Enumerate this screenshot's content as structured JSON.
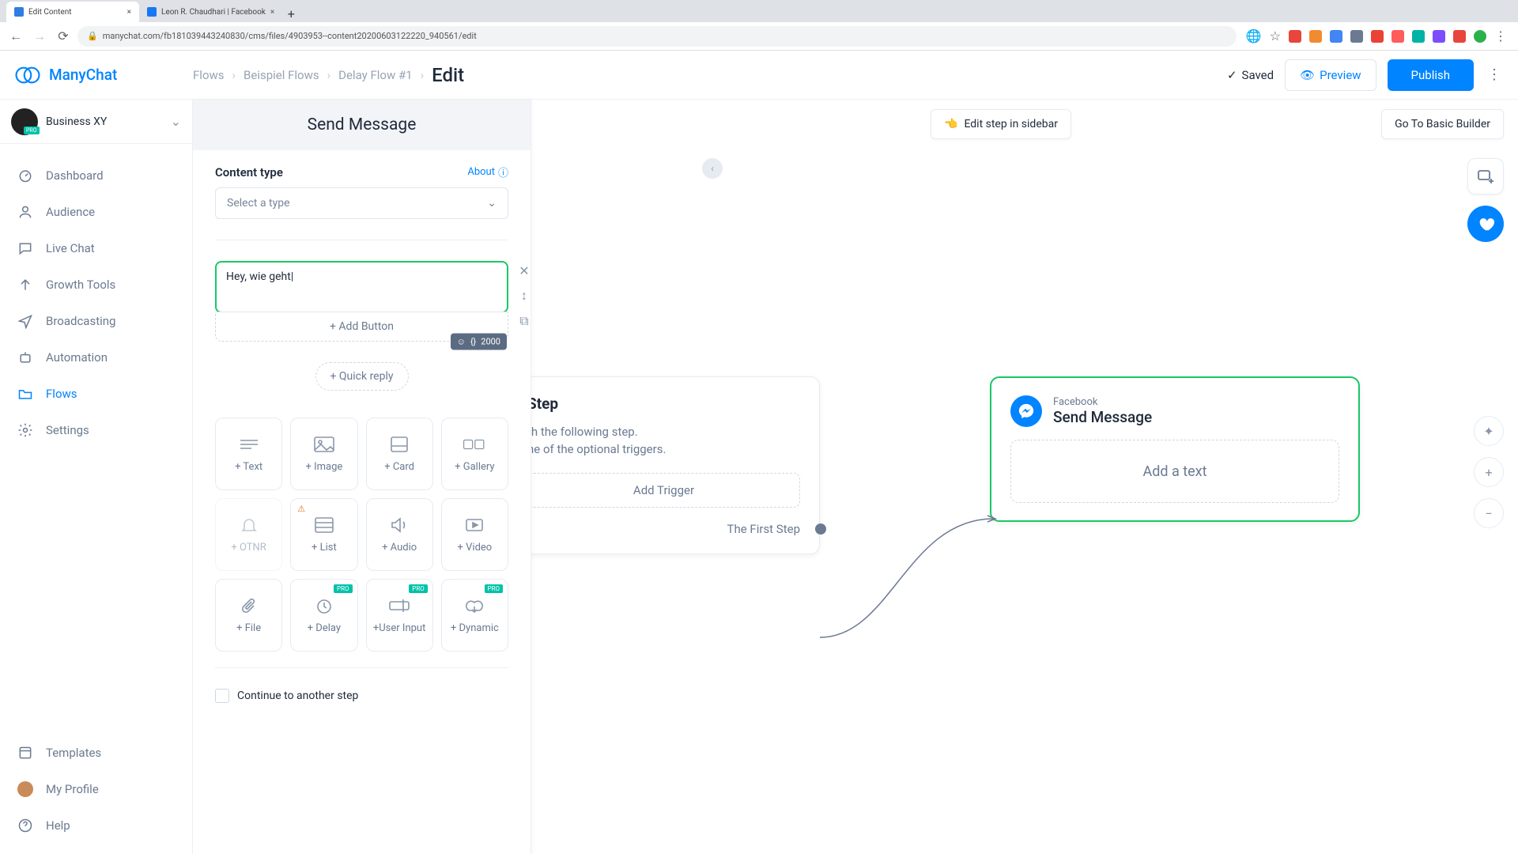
{
  "browser": {
    "tabs": [
      {
        "title": "Edit Content",
        "active": true
      },
      {
        "title": "Leon R. Chaudhari | Facebook",
        "active": false
      }
    ],
    "url": "manychat.com/fb181039443240830/cms/files/4903953--content20200603122220_940561/edit"
  },
  "header": {
    "logo": "ManyChat",
    "breadcrumb": [
      "Flows",
      "Beispiel Flows",
      "Delay Flow #1"
    ],
    "current": "Edit",
    "saved": "Saved",
    "preview": "Preview",
    "publish": "Publish"
  },
  "account": {
    "name": "Business XY",
    "badge": "PRO"
  },
  "nav": {
    "items": [
      {
        "key": "dashboard",
        "label": "Dashboard"
      },
      {
        "key": "audience",
        "label": "Audience"
      },
      {
        "key": "livechat",
        "label": "Live Chat"
      },
      {
        "key": "growth",
        "label": "Growth Tools"
      },
      {
        "key": "broadcasting",
        "label": "Broadcasting"
      },
      {
        "key": "automation",
        "label": "Automation"
      },
      {
        "key": "flows",
        "label": "Flows",
        "active": true
      },
      {
        "key": "settings",
        "label": "Settings"
      }
    ],
    "bottom": [
      {
        "key": "templates",
        "label": "Templates"
      },
      {
        "key": "profile",
        "label": "My Profile"
      },
      {
        "key": "help",
        "label": "Help"
      }
    ]
  },
  "panel": {
    "title": "Send Message",
    "content_type_label": "Content type",
    "about": "About",
    "select_placeholder": "Select a type",
    "message_text": "Hey, wie geht",
    "counter": "2000",
    "add_button": "+ Add Button",
    "quick_reply": "+ Quick reply",
    "blocks": [
      {
        "label": "+ Text",
        "icon": "text"
      },
      {
        "label": "+ Image",
        "icon": "image"
      },
      {
        "label": "+ Card",
        "icon": "card"
      },
      {
        "label": "+ Gallery",
        "icon": "gallery"
      },
      {
        "label": "+ OTNR",
        "icon": "bell",
        "disabled": true
      },
      {
        "label": "+ List",
        "icon": "list",
        "warn": true
      },
      {
        "label": "+ Audio",
        "icon": "audio"
      },
      {
        "label": "+ Video",
        "icon": "video"
      },
      {
        "label": "+ File",
        "icon": "file"
      },
      {
        "label": "+ Delay",
        "icon": "delay",
        "pro": true
      },
      {
        "label": "+User Input",
        "icon": "input",
        "pro": true
      },
      {
        "label": "+ Dynamic",
        "icon": "dynamic",
        "pro": true
      }
    ],
    "continue": "Continue to another step"
  },
  "canvas": {
    "edit_step": "Edit step in sidebar",
    "edit_step_emoji": "👈",
    "basic_builder": "Go To Basic Builder",
    "start": {
      "title": "Step",
      "line1": "th the following step.",
      "line2": "ne of the optional triggers.",
      "add_trigger": "Add Trigger",
      "first_step": "The First Step"
    },
    "send": {
      "platform": "Facebook",
      "title": "Send Message",
      "placeholder": "Add a text"
    }
  }
}
